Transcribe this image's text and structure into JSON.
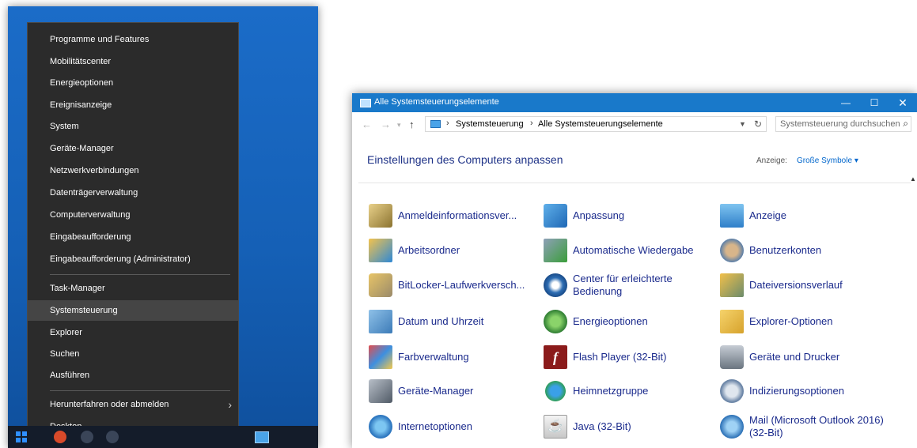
{
  "winx_menu": {
    "group1": [
      "Programme und Features",
      "Mobilitätscenter",
      "Energieoptionen",
      "Ereignisanzeige",
      "System",
      "Geräte-Manager",
      "Netzwerkverbindungen",
      "Datenträgerverwaltung",
      "Computerverwaltung",
      "Eingabeaufforderung",
      "Eingabeaufforderung (Administrator)"
    ],
    "group2": [
      "Task-Manager",
      "Systemsteuerung",
      "Explorer",
      "Suchen",
      "Ausführen"
    ],
    "group3": [
      "Herunterfahren oder abmelden",
      "Desktop"
    ],
    "selected": "Systemsteuerung"
  },
  "control_panel": {
    "title": "Alle Systemsteuerungselemente",
    "breadcrumb": [
      "Systemsteuerung",
      "Alle Systemsteuerungselemente"
    ],
    "search_placeholder": "Systemsteuerung durchsuchen",
    "heading": "Einstellungen des Computers anpassen",
    "view_label": "Anzeige:",
    "view_value": "Große Symbole",
    "items": [
      [
        "Anmeldeinformationsver...",
        "Anpassung",
        "Anzeige"
      ],
      [
        "Arbeitsordner",
        "Automatische Wiedergabe",
        "Benutzerkonten"
      ],
      [
        "BitLocker-Laufwerkversch...",
        "Center für erleichterte Bedienung",
        "Dateiversionsverlauf"
      ],
      [
        "Datum und Uhrzeit",
        "Energieoptionen",
        "Explorer-Optionen"
      ],
      [
        "Farbverwaltung",
        "Flash Player (32-Bit)",
        "Geräte und Drucker"
      ],
      [
        "Geräte-Manager",
        "Heimnetzgruppe",
        "Indizierungsoptionen"
      ],
      [
        "Internetoptionen",
        "Java (32-Bit)",
        "Mail (Microsoft Outlook 2016) (32-Bit)"
      ]
    ],
    "icons": [
      [
        "credential-manager-icon",
        "personalization-icon",
        "display-icon"
      ],
      [
        "work-folders-icon",
        "autoplay-icon",
        "user-accounts-icon"
      ],
      [
        "bitlocker-icon",
        "ease-of-access-icon",
        "file-history-icon"
      ],
      [
        "date-time-icon",
        "power-options-icon",
        "explorer-options-icon"
      ],
      [
        "color-management-icon",
        "flash-player-icon",
        "devices-printers-icon"
      ],
      [
        "device-manager-icon",
        "homegroup-icon",
        "indexing-options-icon"
      ],
      [
        "internet-options-icon",
        "java-icon",
        "mail-icon"
      ]
    ],
    "accent_color": "#1979ca",
    "link_color": "#1a2a8c"
  }
}
